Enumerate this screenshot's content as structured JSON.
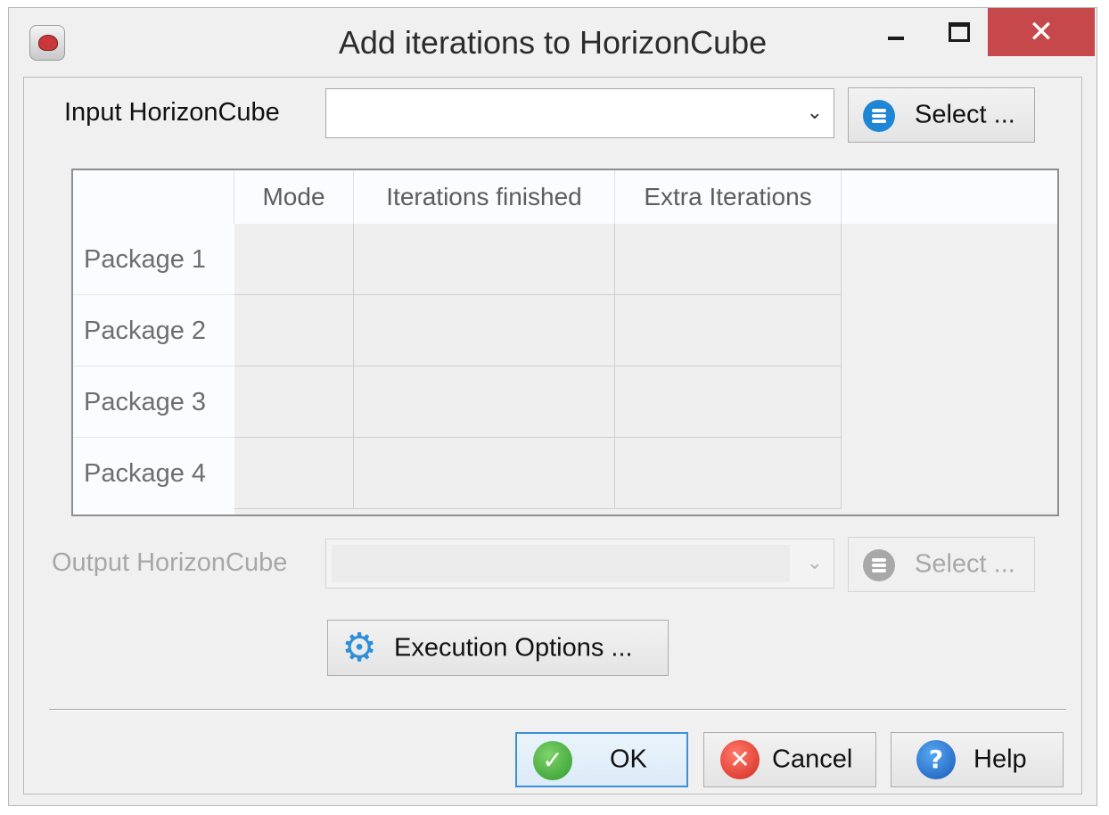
{
  "window": {
    "title": "Add iterations to HorizonCube",
    "close_glyph": "✕"
  },
  "input": {
    "label": "Input HorizonCube",
    "value": "",
    "select_label": "Select ...",
    "select_icon": "list-icon",
    "dropdown_glyph": "⌄"
  },
  "table": {
    "columns": [
      "Mode",
      "Iterations finished",
      "Extra Iterations"
    ],
    "rows": [
      "Package 1",
      "Package 2",
      "Package 3",
      "Package 4"
    ]
  },
  "output": {
    "label": "Output HorizonCube",
    "value": "",
    "select_label": "Select ...",
    "select_icon": "list-icon",
    "dropdown_glyph": "⌄"
  },
  "execution": {
    "label": "Execution Options ...",
    "icon": "gear-icon",
    "icon_glyph": "⚙"
  },
  "footer": {
    "ok_label": "OK",
    "ok_icon_glyph": "✓",
    "cancel_label": "Cancel",
    "cancel_icon_glyph": "✕",
    "help_label": "Help",
    "help_icon_glyph": "?"
  },
  "colors": {
    "close_button": "#c7484a",
    "accent_blue": "#1f86d6",
    "ok_border": "#3d8fd5"
  }
}
